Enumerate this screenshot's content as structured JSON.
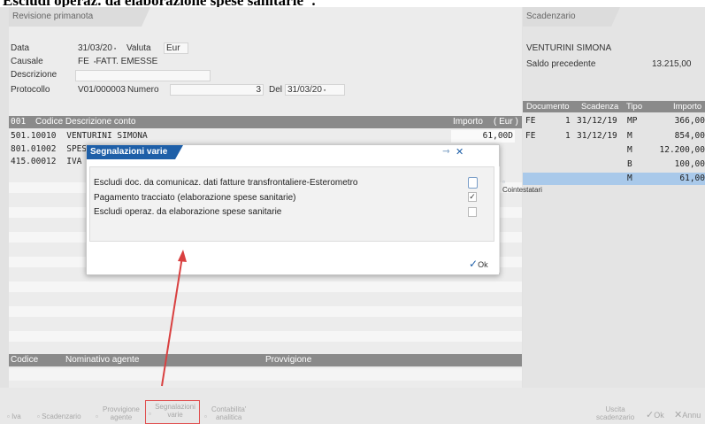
{
  "heading": "Escludi operaz. da elaborazione spese sanitarie\".",
  "left_tab": "Revisione primanota",
  "right_tab": "Scadenzario",
  "form": {
    "data_label": "Data",
    "data_value": "31/03/20",
    "valuta_label": "Valuta",
    "valuta_value": "Eur",
    "causale_label": "Causale",
    "causale_code": "FE",
    "causale_desc": "FATT. EMESSE",
    "descrizione_label": "Descrizione",
    "descrizione_value": "",
    "protocollo_label": "Protocollo",
    "protocollo_value": "V01/000003",
    "numero_label": "Numero",
    "numero_value": "3",
    "del_label": "Del",
    "del_value": "31/03/20"
  },
  "grid": {
    "headers": {
      "code": "001",
      "desc": "Codice Descrizione conto",
      "importo": "Importo",
      "currency": "( Eur )"
    },
    "rows": [
      {
        "code": "501.10010",
        "desc": "VENTURINI SIMONA",
        "amount": "61,00D"
      },
      {
        "code": "801.01002",
        "desc": "SPES",
        "amount": ""
      },
      {
        "code": "415.00012",
        "desc": "IVA",
        "amount": ""
      }
    ]
  },
  "agent_grid": {
    "codice": "Codice",
    "nominativo": "Nominativo agente",
    "provvigione": "Provvigione"
  },
  "scadenzario": {
    "name": "VENTURINI SIMONA",
    "saldo_label": "Saldo precedente",
    "saldo_value": "13.215,00",
    "headers": {
      "documento": "Documento",
      "scadenza": "Scadenza",
      "tipo": "Tipo",
      "importo": "Importo"
    },
    "rows": [
      {
        "doc": "FE",
        "num": "1",
        "date": "31/12/19",
        "tipo": "MP",
        "amount": "366,00"
      },
      {
        "doc": "FE",
        "num": "1",
        "date": "31/12/19",
        "tipo": "M",
        "amount": "854,00"
      },
      {
        "doc": "",
        "num": "",
        "date": "",
        "tipo": "M",
        "amount": "12.200,00"
      },
      {
        "doc": "",
        "num": "",
        "date": "",
        "tipo": "B",
        "amount": "100,00"
      },
      {
        "doc": "",
        "num": "",
        "date": "",
        "tipo": "M",
        "amount": "61,00"
      }
    ]
  },
  "modal": {
    "title": "Segnalazioni varie",
    "options": [
      {
        "label": "Escludi doc. da comunicaz. dati fatture transfrontaliere-Esterometro",
        "checked": false
      },
      {
        "label": "Pagamento tracciato (elaborazione spese sanitarie)",
        "checked": true
      },
      {
        "label": "Escludi operaz. da elaborazione spese sanitarie",
        "checked": false
      }
    ],
    "side_item": "Cointestatari",
    "ok_label": "Ok",
    "check_glyph": "✓"
  },
  "toolbar": {
    "iva": "Iva",
    "scadenzario": "Scadenzario",
    "provvigione_1": "Provvigione",
    "provvigione_2": "agente",
    "segnalazioni_1": "Segnalazioni",
    "segnalazioni_2": "varie",
    "contabilita_1": "Contabilita'",
    "contabilita_2": "analitica",
    "uscita_1": "Uscita",
    "uscita_2": "scadenzario",
    "ok": "Ok",
    "annulla": "Annu"
  },
  "colors": {
    "accent": "#1e5fa8",
    "selected_row": "#a9c9ea",
    "highlight_box": "#e05050",
    "arrow": "#d94040"
  }
}
